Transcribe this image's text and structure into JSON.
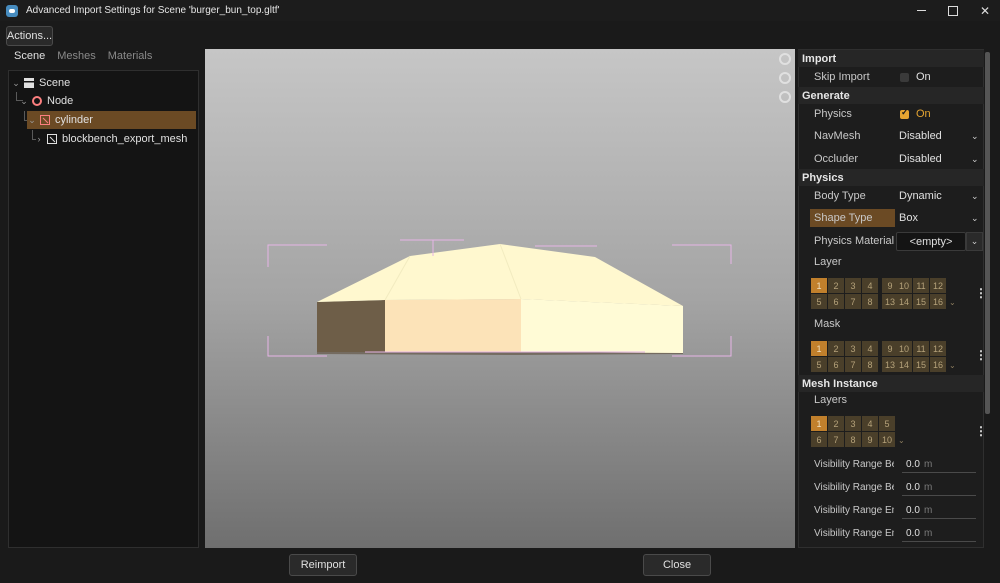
{
  "window": {
    "title": "Advanced Import Settings for Scene 'burger_bun_top.gltf'",
    "controls": {
      "minimize": "",
      "maximize": "",
      "close": "✕"
    }
  },
  "toolbar": {
    "actions_label": "Actions..."
  },
  "left_tabs": [
    "Scene",
    "Meshes",
    "Materials"
  ],
  "tree": {
    "scene": "Scene",
    "node": "Node",
    "cylinder": "cylinder",
    "mesh": "blockbench_export_mesh"
  },
  "inspector": {
    "import": {
      "header": "Import",
      "skip_import_label": "Skip Import",
      "skip_import_value": "On",
      "skip_import_checked": false
    },
    "generate": {
      "header": "Generate",
      "physics_label": "Physics",
      "physics_value": "On",
      "physics_checked": true,
      "navmesh_label": "NavMesh",
      "navmesh_value": "Disabled",
      "occluder_label": "Occluder",
      "occluder_value": "Disabled"
    },
    "physics": {
      "header": "Physics",
      "body_type_label": "Body Type",
      "body_type_value": "Dynamic",
      "shape_type_label": "Shape Type",
      "shape_type_value": "Box",
      "physics_material_label": "Physics Material O",
      "physics_material_value": "<empty>",
      "layer_label": "Layer",
      "mask_label": "Mask",
      "layer_bits": [
        "1",
        "2",
        "3",
        "4",
        "9",
        "10",
        "11",
        "12",
        "5",
        "6",
        "7",
        "8",
        "13",
        "14",
        "15",
        "16"
      ],
      "active_bit": "1"
    },
    "mesh_instance": {
      "header": "Mesh Instance",
      "layers_label": "Layers",
      "layer_bits": [
        "1",
        "2",
        "3",
        "4",
        "5",
        "6",
        "7",
        "8",
        "9",
        "10"
      ],
      "visibility": [
        {
          "label": "Visibility Range Be",
          "value": "0.0",
          "unit": "m"
        },
        {
          "label": "Visibility Range Be",
          "value": "0.0",
          "unit": "m"
        },
        {
          "label": "Visibility Range En",
          "value": "0.0",
          "unit": "m"
        },
        {
          "label": "Visibility Range En",
          "value": "0.0",
          "unit": "m"
        }
      ]
    }
  },
  "footer": {
    "reimport_label": "Reimport",
    "close_label": "Close"
  },
  "colors": {
    "accent": "#e6a531",
    "selection": "#6b4a24",
    "bun_top": "#fffbd6",
    "bun_side": "#fce3b8",
    "bun_dark": "#6e5e48"
  }
}
